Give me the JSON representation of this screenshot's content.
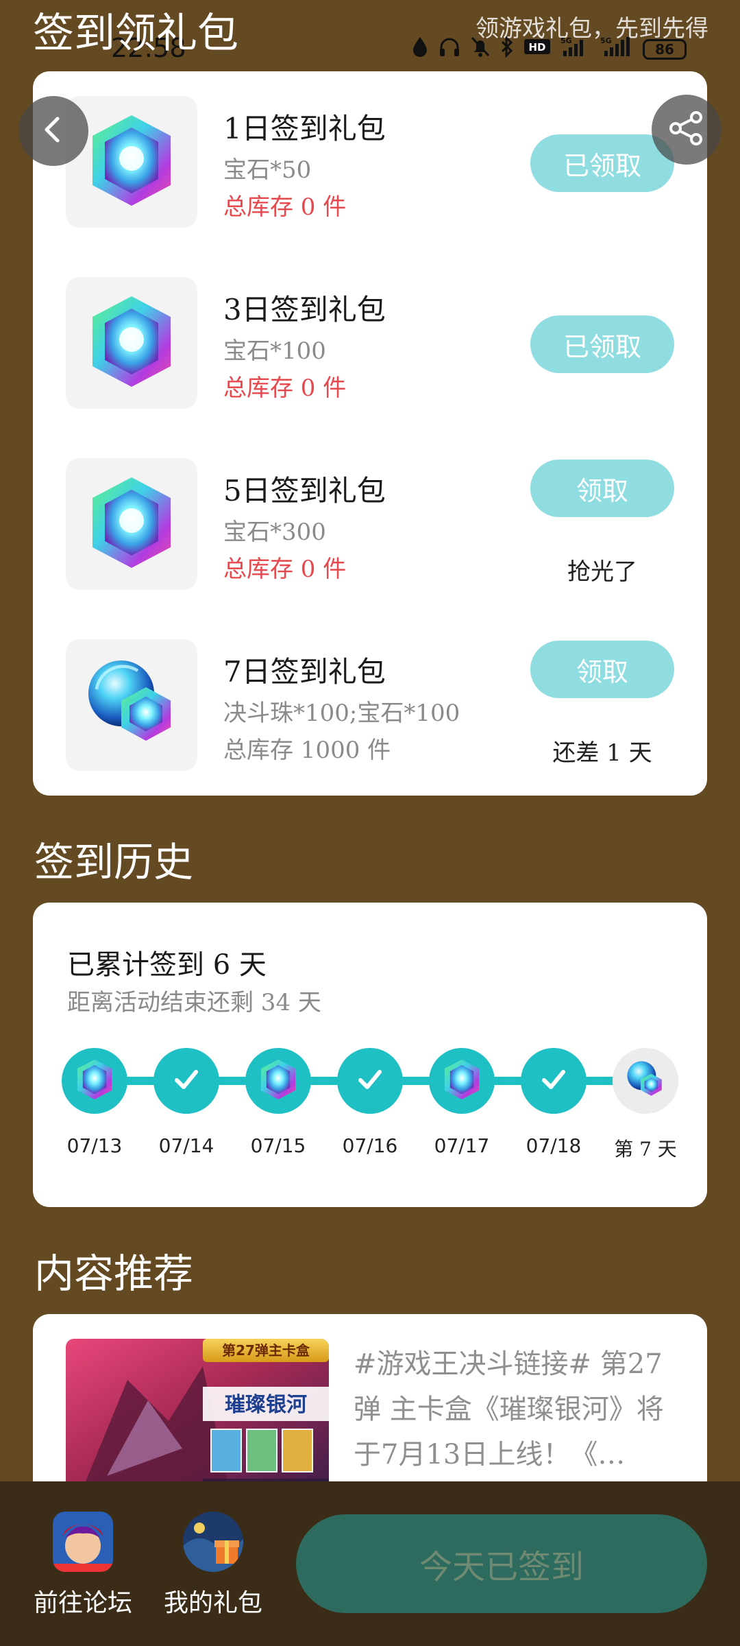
{
  "status_bar": {
    "time": "22:58",
    "battery": "86"
  },
  "header": {
    "title": "签到领礼包",
    "slogan": "领游戏礼包，先到先得"
  },
  "gifts": [
    {
      "name": "1日签到礼包",
      "content": "宝石*50",
      "stock": "总库存 0 件",
      "button": "已领取",
      "note": ""
    },
    {
      "name": "3日签到礼包",
      "content": "宝石*100",
      "stock": "总库存 0 件",
      "button": "已领取",
      "note": ""
    },
    {
      "name": "5日签到礼包",
      "content": "宝石*300",
      "stock": "总库存 0 件",
      "button": "领取",
      "note": "抢光了"
    },
    {
      "name": "7日签到礼包",
      "content": "决斗珠*100;宝石*100",
      "stock": "总库存 1000 件",
      "button": "领取",
      "note": "还差 1 天"
    }
  ],
  "history": {
    "title": "签到历史",
    "total": "已累计签到 6 天",
    "remaining": "距离活动结束还剩 34 天",
    "days": [
      {
        "label": "07/13",
        "icon": "gem-icon",
        "status": "checked"
      },
      {
        "label": "07/14",
        "icon": "check-icon",
        "status": "checked"
      },
      {
        "label": "07/15",
        "icon": "gem-icon",
        "status": "checked"
      },
      {
        "label": "07/16",
        "icon": "check-icon",
        "status": "checked"
      },
      {
        "label": "07/17",
        "icon": "gem-icon",
        "status": "checked"
      },
      {
        "label": "07/18",
        "icon": "check-icon",
        "status": "checked"
      },
      {
        "label": "第 7 天",
        "icon": "orb-gem-icon",
        "status": "pending"
      }
    ]
  },
  "recommend": {
    "title": "内容推荐",
    "image_caption": "第27弹主卡盒",
    "image_title": "璀璨银河",
    "article": "#游戏王决斗链接# 第27弹 主卡盒《璀璨银河》将于7月13日上线！《…"
  },
  "bottom_bar": {
    "forum_label": "前往论坛",
    "gifts_label": "我的礼包",
    "checkin_label": "今天已签到"
  },
  "colors": {
    "background": "#644a22",
    "accent": "#1fc0c4",
    "button_light": "#8fdde0",
    "stock_red": "#e5484d",
    "checkin_button": "#2d6b5e"
  }
}
